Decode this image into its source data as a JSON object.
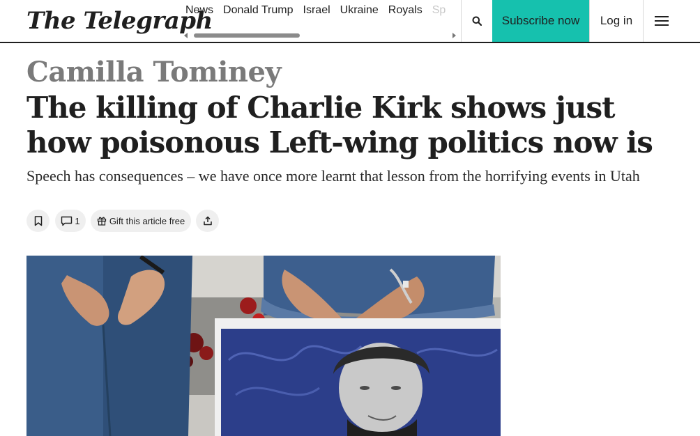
{
  "header": {
    "logo": "The Telegraph",
    "nav": [
      {
        "label": "News"
      },
      {
        "label": "Donald Trump"
      },
      {
        "label": "Israel"
      },
      {
        "label": "Ukraine"
      },
      {
        "label": "Royals"
      },
      {
        "label": "Sp"
      }
    ],
    "search_icon": "search-icon",
    "subscribe_label": "Subscribe now",
    "login_label": "Log in",
    "menu_icon": "hamburger-menu-icon"
  },
  "article": {
    "author": "Camilla Tominey",
    "headline": "The killing of Charlie Kirk shows just how poisonous Left-wing politics now is",
    "standfirst": "Speech has consequences – we have once more learnt that lesson from the horrifying events in Utah",
    "actions": {
      "bookmark_icon": "bookmark-icon",
      "comment_icon": "comment-icon",
      "comment_count": "1",
      "gift_icon": "gift-icon",
      "gift_label": "Gift this article free",
      "share_icon": "share-icon"
    }
  },
  "colors": {
    "accent": "#16c1ae",
    "text": "#1f1f1f",
    "author": "#7a7a7a",
    "pill_bg": "#efefef"
  }
}
